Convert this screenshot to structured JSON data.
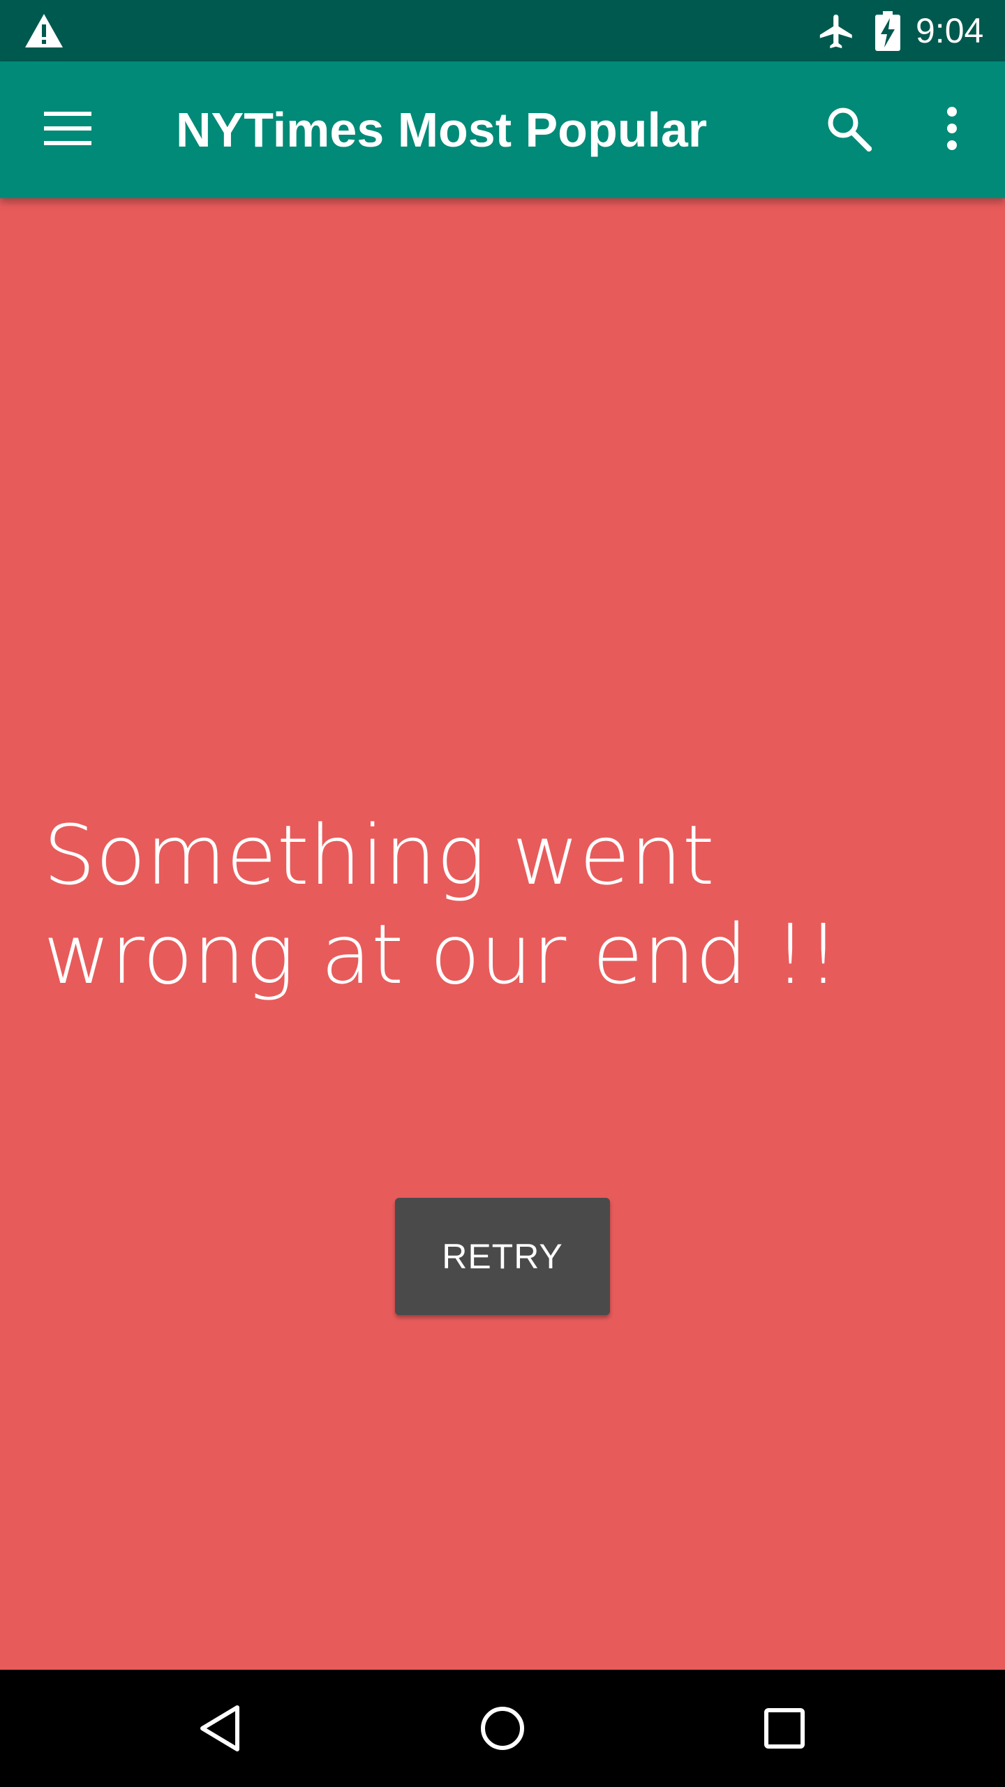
{
  "status_bar": {
    "time": "9:04",
    "icons": [
      "warning-icon",
      "airplane-mode-icon",
      "battery-charging-icon"
    ]
  },
  "app_bar": {
    "title": "NYTimes Most Popular",
    "icons": [
      "menu-icon",
      "search-icon",
      "more-vert-icon"
    ]
  },
  "content": {
    "error_message": "Something went wrong at our end !!",
    "retry_label": "RETRY"
  },
  "navigation_bar": {
    "icons": [
      "back-icon",
      "home-icon",
      "recents-icon"
    ]
  },
  "colors": {
    "status_bar": "#00594f",
    "app_bar": "#008a77",
    "background": "#e85b5b",
    "retry_button": "#4a4a4a",
    "nav_bar": "#000000"
  }
}
